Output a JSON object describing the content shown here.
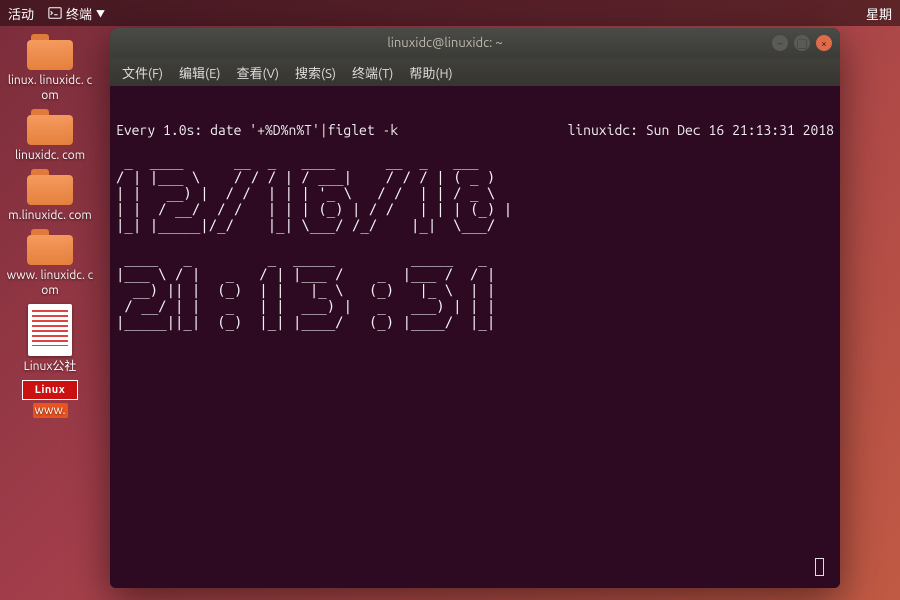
{
  "topbar": {
    "activities": "活动",
    "app_label": "终端",
    "clock_weekday_fragment": "星期"
  },
  "desktop_icons": [
    {
      "type": "folder",
      "label": "linux.\nlinuxidc.\ncom"
    },
    {
      "type": "folder",
      "label": "linuxidc.\ncom"
    },
    {
      "type": "folder",
      "label": "m.linuxidc.\ncom"
    },
    {
      "type": "folder",
      "label": "www.\nlinuxidc.\ncom"
    },
    {
      "type": "doc",
      "label": "Linux公社"
    },
    {
      "type": "logo",
      "label": "www.",
      "logo_text": "Linux"
    }
  ],
  "terminal": {
    "title": "linuxidc@linuxidc: ~",
    "window_buttons": {
      "minimize_glyph": "–",
      "maximize_glyph": "▢",
      "close_glyph": "×"
    },
    "menu": [
      "文件(F)",
      "编辑(E)",
      "查看(V)",
      "搜索(S)",
      "终端(T)",
      "帮助(H)"
    ],
    "status_left": "Every 1.0s: date '+%D%n%T'|figlet -k",
    "status_right": "linuxidc: Sun Dec 16 21:13:31 2018",
    "date_value": "12/16/18",
    "time_value": "21:13:31",
    "ascii_art": " _  ____      __  _   ____      __  _   ___  \n/ | |___ \\    / / / | / ___|    / / / | ( _ ) \n| |   __) |  / /  | | | '_ \\   / /  | | / _ \\ \n| |  / __/  / /   | | | (_) | / /   | | | (_) |\n|_| |_____|/_/    |_| \\___/ /_/    |_|  \\___/ \n\n ____   _         _  _____         _____   _ \n|___ \\ / |   _   / | |___ /    _  |___ /  / |\n  __) || |  (_)  | |   |_ \\   (_)   |_ \\  | |\n / __/ | |   _   | |  ___) |   _   ___) | | |\n|_____||_|  (_)  |_| |____/   (_) |____/  |_|"
  }
}
